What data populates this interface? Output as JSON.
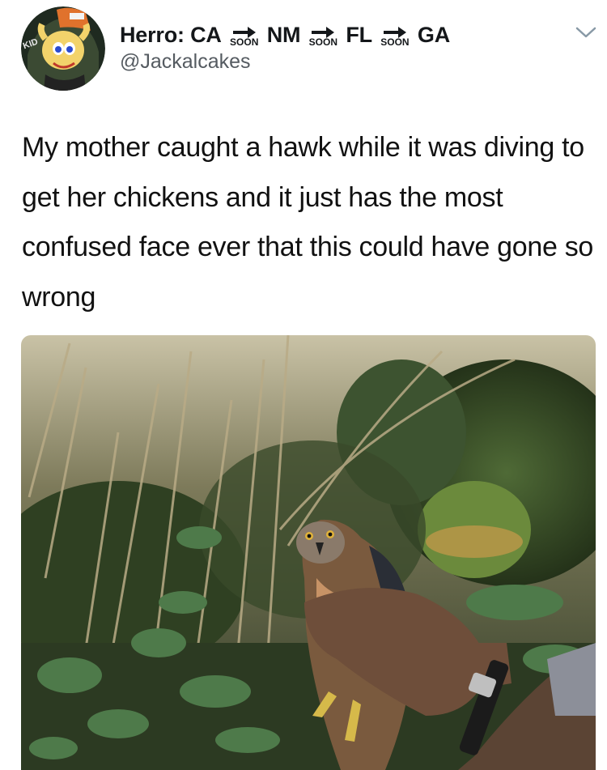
{
  "author": {
    "name_segments": [
      "Herro: CA",
      "NM",
      "FL",
      "GA"
    ],
    "arrow_label": "SOON",
    "handle": "@Jackalcakes"
  },
  "avatar_text": "KID",
  "tweet": {
    "text": "My mother caught a hawk while it was diving to get her chickens and it just has the most confused face ever that this could have gone so wrong"
  },
  "icons": {
    "menu": "chevron-down-icon",
    "route": "arrow-right-icon"
  },
  "photo": {
    "subject": "hawk held in hands among bushes"
  }
}
